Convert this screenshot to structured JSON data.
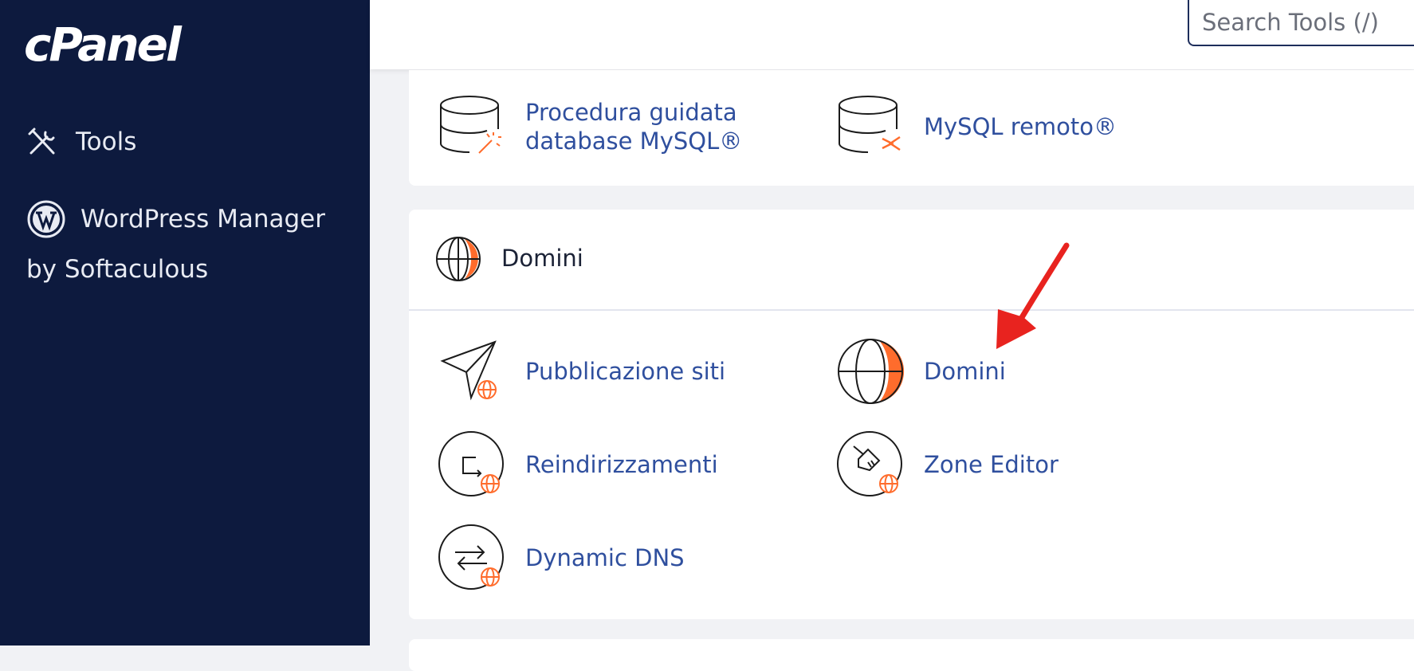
{
  "app": {
    "logo": "cPanel"
  },
  "sidebar": {
    "items": [
      {
        "label": "Tools",
        "icon": "tools-icon"
      },
      {
        "label": "WordPress Manager",
        "sublabel": "by Softaculous",
        "icon": "wordpress-icon"
      }
    ]
  },
  "search": {
    "placeholder": "Search Tools (/)"
  },
  "database_section": {
    "items": [
      {
        "label": "Procedura guidata database MySQL®",
        "icon": "database-wizard-icon"
      },
      {
        "label": "MySQL remoto®",
        "icon": "database-remote-icon"
      }
    ]
  },
  "domains_section": {
    "title": "Domini",
    "icon": "globe-icon",
    "items": [
      {
        "label": "Pubblicazione siti",
        "icon": "site-publisher-icon"
      },
      {
        "label": "Domini",
        "icon": "domains-globe-icon"
      },
      {
        "label": "Reindirizzamenti",
        "icon": "redirects-icon"
      },
      {
        "label": "Zone Editor",
        "icon": "zone-editor-icon"
      },
      {
        "label": "Dynamic DNS",
        "icon": "dynamic-dns-icon"
      }
    ]
  },
  "colors": {
    "sidebar": "#0d1a3e",
    "accent": "#ff6c2c",
    "link": "#2f4f9e",
    "annotation": "#e8231f"
  }
}
